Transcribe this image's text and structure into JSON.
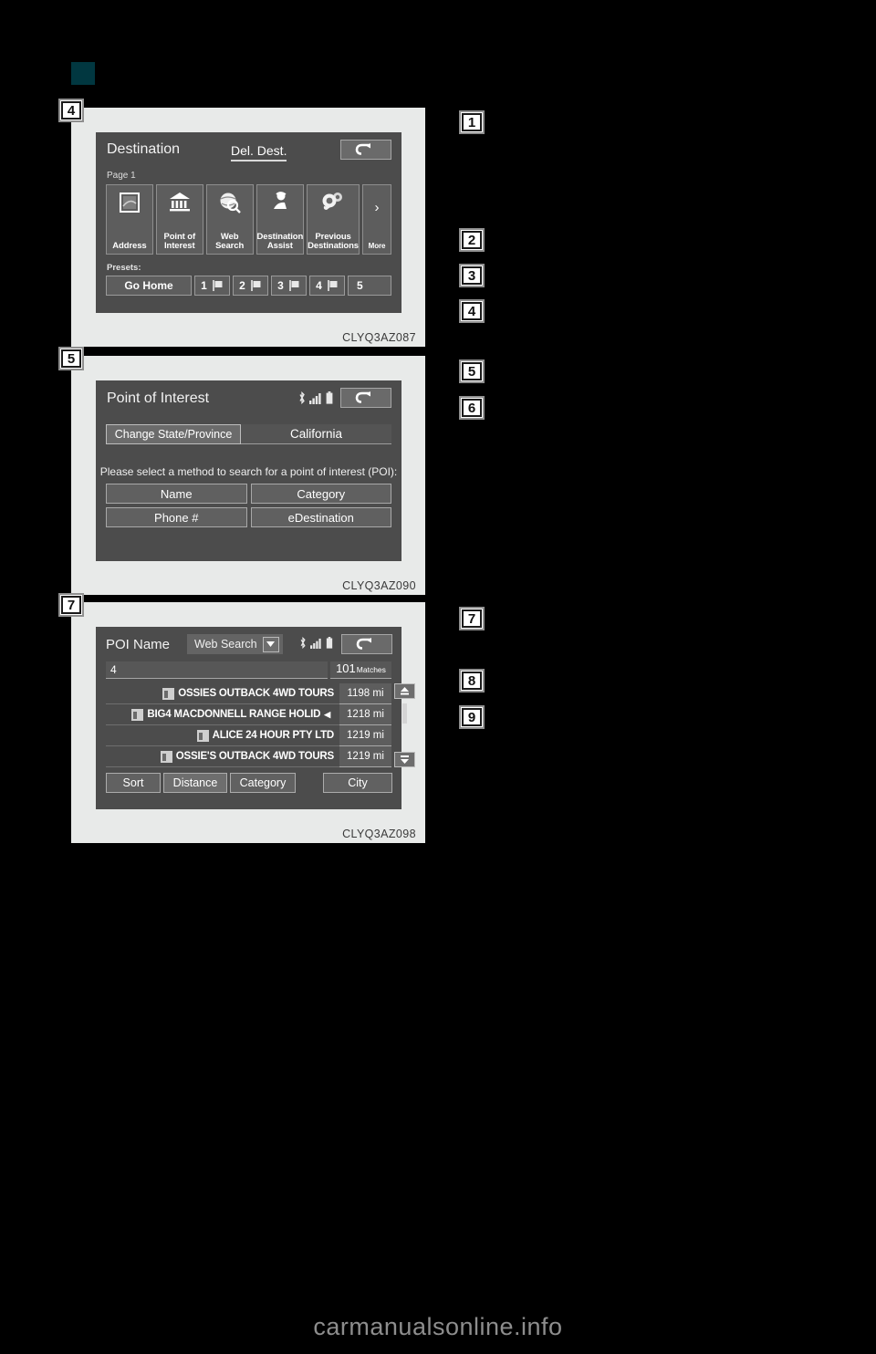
{
  "page": {
    "background": "#000000",
    "marker_color": "#013740",
    "watermark": "carmanualsonline.info"
  },
  "callouts": [
    {
      "number": "1"
    },
    {
      "number": "2"
    },
    {
      "number": "3"
    },
    {
      "number": "4"
    },
    {
      "number": "5"
    },
    {
      "number": "6"
    },
    {
      "number": "7"
    },
    {
      "number": "8"
    },
    {
      "number": "9"
    }
  ],
  "figures": [
    {
      "badge": "4",
      "code": "CLYQ3AZ087",
      "screen": {
        "title": "Destination",
        "delete_destination": "Del. Dest.",
        "back_icon": "back-arrow-icon",
        "page_label": "Page 1",
        "menu": [
          {
            "label_line1": "Address",
            "label_line2": "",
            "icon": "map-card-icon"
          },
          {
            "label_line1": "Point of",
            "label_line2": "Interest",
            "icon": "bank-building-icon"
          },
          {
            "label_line1": "Web",
            "label_line2": "Search",
            "icon": "globe-magnifier-icon"
          },
          {
            "label_line1": "Destination",
            "label_line2": "Assist",
            "icon": "headset-operator-icon"
          },
          {
            "label_line1": "Previous",
            "label_line2": "Destinations",
            "icon": "clock-history-icon"
          },
          {
            "label_line1": "More",
            "label_line2": "",
            "icon": "chevron-right-icon"
          }
        ],
        "presets_label": "Presets:",
        "presets": [
          {
            "label": "Go Home",
            "flag": false
          },
          {
            "label": "1",
            "flag": true
          },
          {
            "label": "2",
            "flag": true
          },
          {
            "label": "3",
            "flag": true
          },
          {
            "label": "4",
            "flag": true
          },
          {
            "label": "5",
            "flag": false
          }
        ]
      }
    },
    {
      "badge": "5",
      "code": "CLYQ3AZ090",
      "screen": {
        "title": "Point of Interest",
        "status_icons": [
          "bluetooth-icon",
          "signal-bars-icon",
          "battery-icon"
        ],
        "back_icon": "back-arrow-icon",
        "change_state_button": "Change State/Province",
        "state_value": "California",
        "prompt": "Please select a method to search for a point of interest (POI):",
        "methods": [
          "Name",
          "Category",
          "Phone #",
          "eDestination"
        ]
      }
    },
    {
      "badge": "7",
      "code": "CLYQ3AZ098",
      "screen": {
        "title": "POI Name",
        "source_label": "Web Search",
        "source_caret": "chevron-down-icon",
        "status_icons": [
          "bluetooth-icon",
          "signal-bars-icon",
          "battery-icon"
        ],
        "back_icon": "back-arrow-icon",
        "search_value": "4",
        "match_count": "101",
        "match_word": "Matches",
        "results": [
          {
            "name": "OSSIES OUTBACK 4WD TOURS",
            "distance": "1198 mi",
            "selected": false
          },
          {
            "name": "BIG4 MACDONNELL RANGE HOLID",
            "distance": "1218 mi",
            "selected": true
          },
          {
            "name": "ALICE 24 HOUR PTY LTD",
            "distance": "1219 mi",
            "selected": false
          },
          {
            "name": "OSSIE'S OUTBACK 4WD TOURS",
            "distance": "1219 mi",
            "selected": false
          }
        ],
        "scroll_up_icon": "scroll-up-icon",
        "scroll_down_icon": "scroll-down-icon",
        "bottom_buttons": [
          "Sort",
          "Distance",
          "Category",
          "City"
        ]
      }
    }
  ]
}
